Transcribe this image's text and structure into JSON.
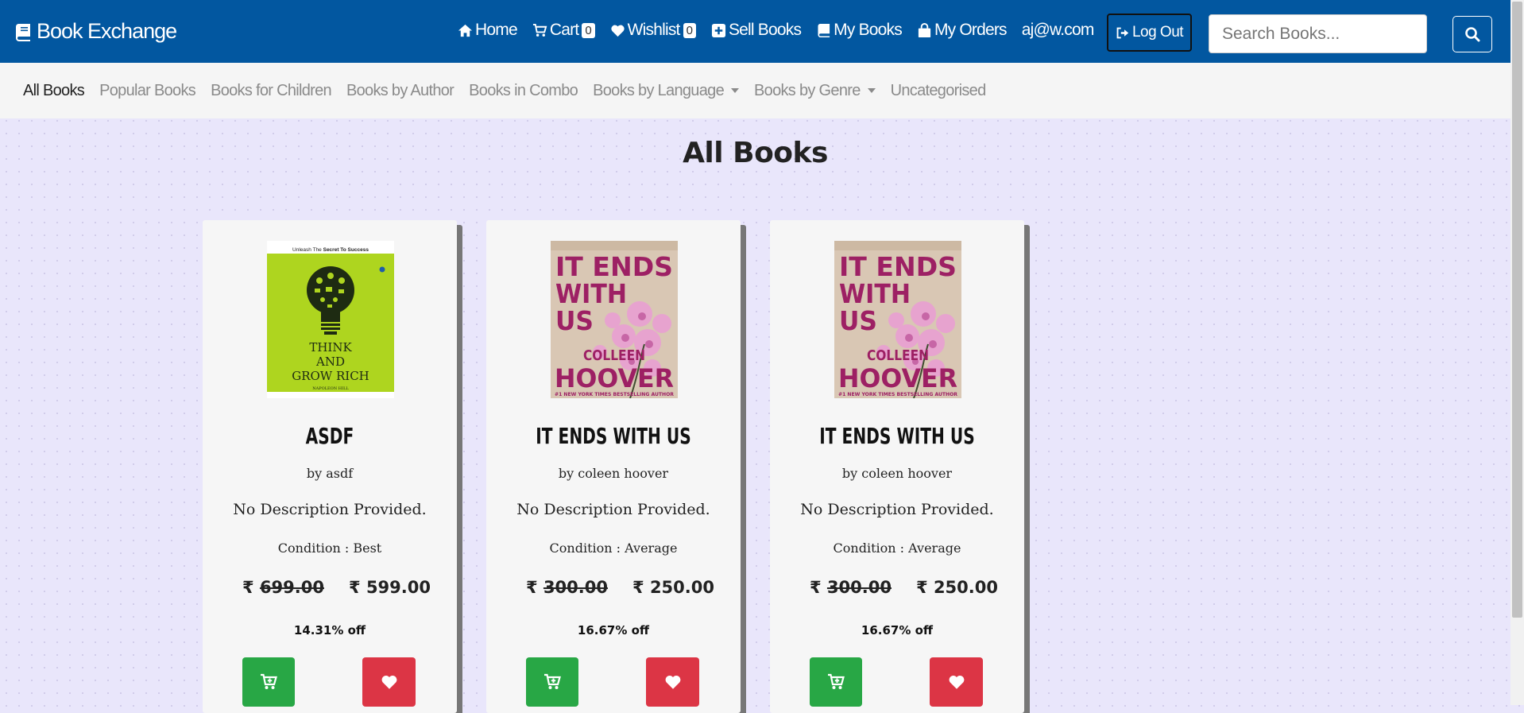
{
  "brand": {
    "name": "Book Exchange",
    "icon": "book-icon"
  },
  "nav": {
    "home": "Home",
    "cart": "Cart",
    "cart_count": "0",
    "wishlist": "Wishlist",
    "wishlist_count": "0",
    "sell": "Sell Books",
    "my_books": "My Books",
    "my_orders": "My Orders",
    "user_email": "aj@w.com",
    "logout": "Log Out"
  },
  "search": {
    "placeholder": "Search Books..."
  },
  "subnav": {
    "all": "All Books",
    "popular": "Popular Books",
    "children": "Books for Children",
    "author": "Books by Author",
    "combo": "Books in Combo",
    "language": "Books by Language",
    "genre": "Books by Genre",
    "uncategorised": "Uncategorised"
  },
  "page_title": "All Books",
  "books": [
    {
      "title": "ASDF",
      "author": "by asdf",
      "description": "No Description Provided.",
      "condition": "Condition : Best",
      "currency": "₹",
      "old_price": "699.00",
      "new_price": "599.00",
      "discount": "14.31% off",
      "cover": {
        "tagline_pre": "Unleash The",
        "tagline_bold": "Secret To Success",
        "line1": "THINK",
        "line2": "AND",
        "line3": "GROW RICH",
        "author": "NAPOLEON HILL"
      }
    },
    {
      "title": "IT ENDS WITH US",
      "author": "by coleen hoover",
      "description": "No Description Provided.",
      "condition": "Condition : Average",
      "currency": "₹",
      "old_price": "300.00",
      "new_price": "250.00",
      "discount": "16.67% off",
      "cover": {
        "l1": "IT ENDS",
        "l2": "WITH",
        "l3": "US",
        "a1": "COLLEEN",
        "a2": "HOOVER",
        "bottom": "#1 NEW YORK TIMES BESTSELLING AUTHOR"
      }
    },
    {
      "title": "IT ENDS WITH US",
      "author": "by coleen hoover",
      "description": "No Description Provided.",
      "condition": "Condition : Average",
      "currency": "₹",
      "old_price": "300.00",
      "new_price": "250.00",
      "discount": "16.67% off",
      "cover": {
        "l1": "IT ENDS",
        "l2": "WITH",
        "l3": "US",
        "a1": "COLLEEN",
        "a2": "HOOVER",
        "bottom": "#1 NEW YORK TIMES BESTSELLING AUTHOR"
      }
    }
  ],
  "colors": {
    "navbar": "#0257a0",
    "subnav": "#f5f5f5",
    "background": "#e9e6fb",
    "add_to_cart": "#28a745",
    "wishlist": "#dc3545",
    "cover_green": "#aed51f",
    "cover_pink": "#9d2064"
  }
}
